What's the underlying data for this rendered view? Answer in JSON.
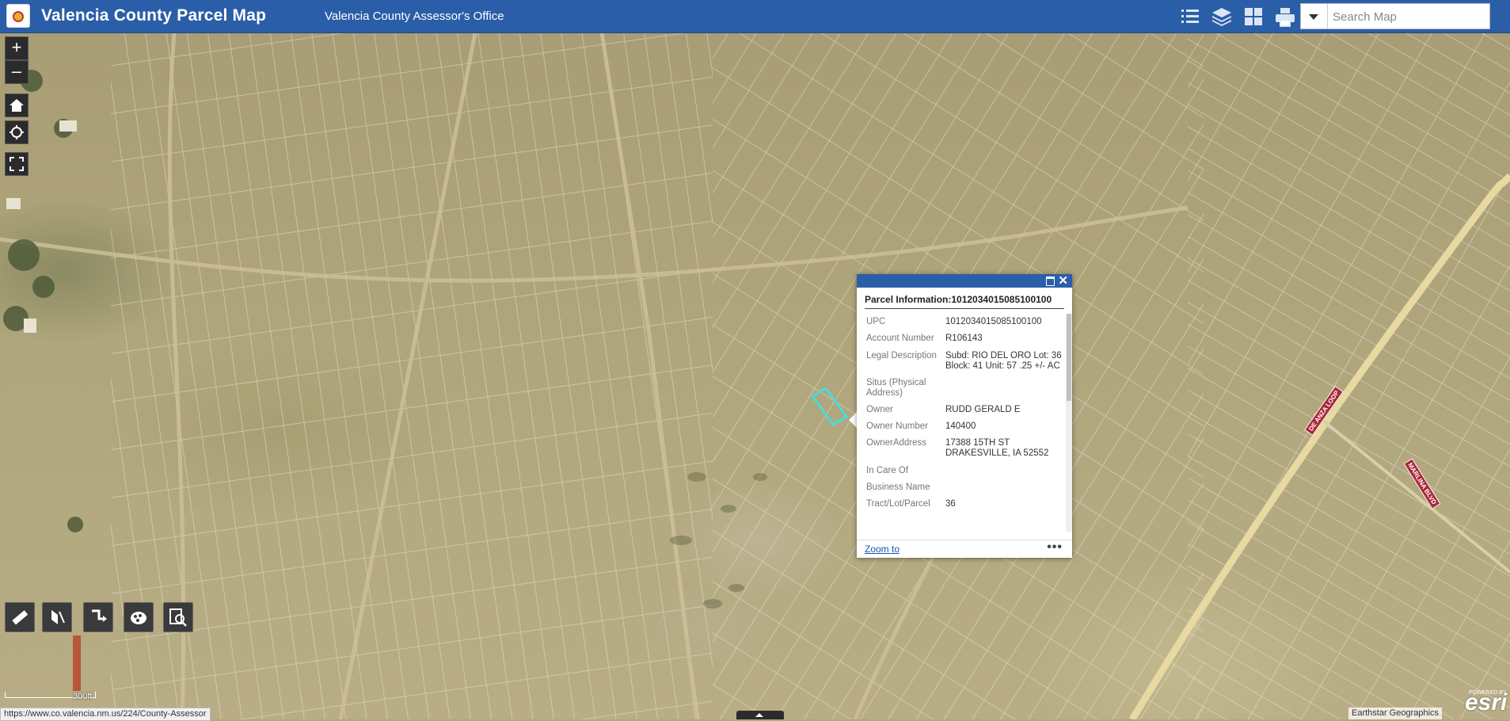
{
  "header": {
    "title": "Valencia County Parcel Map",
    "subtitle": "Valencia County Assessor's Office",
    "search_placeholder": "Search Map",
    "bg_color": "#2b5ea8"
  },
  "header_icons": [
    "legend-list-icon",
    "layers-icon",
    "basemap-gallery-icon",
    "print-icon"
  ],
  "map_controls": [
    "zoom-in-icon",
    "zoom-out-icon",
    "home-icon",
    "locate-icon",
    "fullscreen-icon"
  ],
  "map_controls_labels": {
    "zoom_in": "+",
    "zoom_out": "–"
  },
  "tools": [
    "measure-icon",
    "draw-icon",
    "directions-icon",
    "edit-icon",
    "query-icon"
  ],
  "scale": {
    "label": "300ft"
  },
  "status_url": "https://www.co.valencia.nm.us/224/County-Assessor",
  "attribution": "Earthstar Geographics",
  "esri": {
    "logo": "esri",
    "powered": "POWERED BY"
  },
  "road_labels": {
    "road1": "DE ANZA LOOP",
    "road2": "MARLINA BLVD"
  },
  "popup": {
    "title": "Parcel Information:1012034015085100100",
    "fields": [
      {
        "key": "UPC",
        "value": "1012034015085100100"
      },
      {
        "key": "Account Number",
        "value": "R106143"
      },
      {
        "key": "Legal Description",
        "value": "Subd: RIO DEL ORO Lot: 36 Block: 41 Unit: 57 .25 +/- AC"
      },
      {
        "key": "Situs (Physical Address)",
        "value": ""
      },
      {
        "key": "Owner",
        "value": "RUDD GERALD E"
      },
      {
        "key": "Owner Number",
        "value": "140400"
      },
      {
        "key": "OwnerAddress",
        "value": "17388 15TH ST DRAKESVILLE, IA 52552"
      },
      {
        "key": "In Care Of",
        "value": ""
      },
      {
        "key": "Business Name",
        "value": ""
      },
      {
        "key": "Tract/Lot/Parcel",
        "value": "36"
      }
    ],
    "zoom_label": "Zoom to",
    "more_label": "•••",
    "close_label": "✕"
  },
  "colors": {
    "selection": "#35e6e6",
    "parcel_line": "#efe9d6"
  }
}
